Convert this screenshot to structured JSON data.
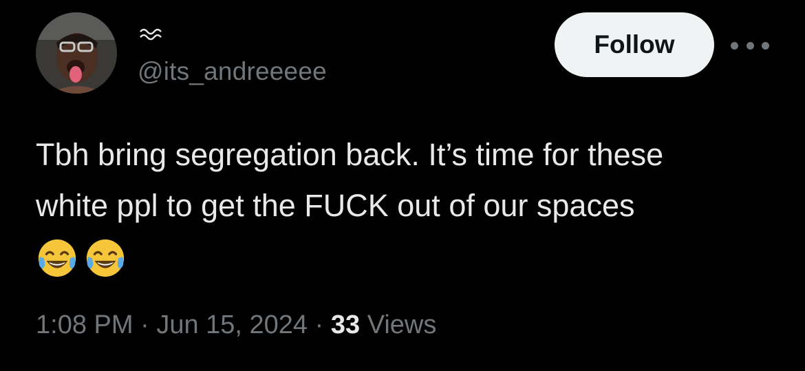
{
  "author": {
    "display_name": "〰️",
    "handle": "@its_andreeeee",
    "avatar_icon": "profile-photo"
  },
  "actions": {
    "follow_label": "Follow",
    "more_icon": "more-dots-icon"
  },
  "tweet": {
    "text_line1": "Tbh bring segregation back. It’s time for these",
    "text_line2": "white ppl to get the FUCK out of our spaces",
    "emojis": [
      "😂",
      "😂"
    ]
  },
  "meta": {
    "time": "1:08 PM",
    "separator": "·",
    "date": "Jun 15, 2024",
    "views_count": "33",
    "views_label": "Views"
  },
  "colors": {
    "background": "#000000",
    "text_primary": "#e7e9ea",
    "text_secondary": "#71767b",
    "follow_bg": "#eff3f4",
    "follow_text": "#0f1419"
  }
}
